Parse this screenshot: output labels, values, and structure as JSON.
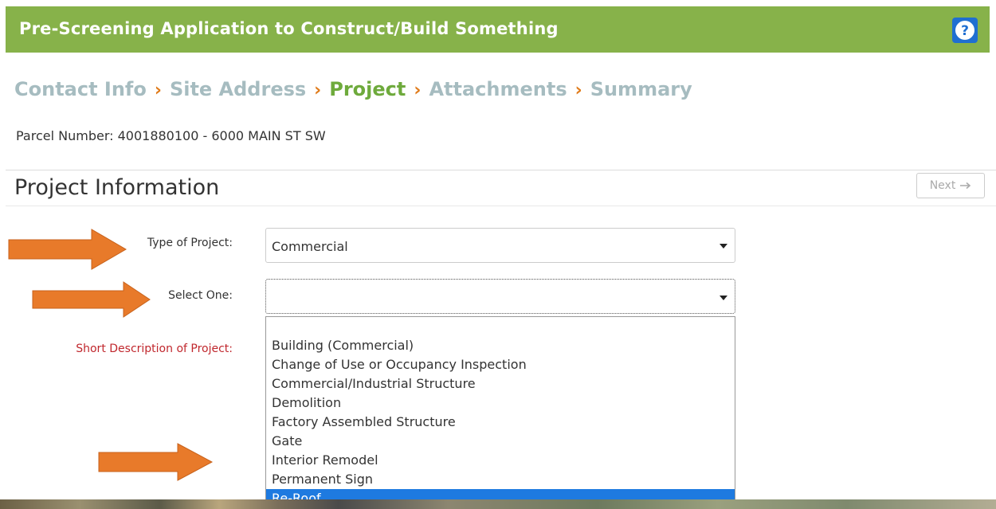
{
  "header": {
    "title": "Pre-Screening Application to Construct/Build Something",
    "help_icon": "question-circle-icon",
    "bg_color": "#87b24a",
    "help_color": "#1f6fd1"
  },
  "breadcrumb": {
    "steps": [
      "Contact Info",
      "Site Address",
      "Project",
      "Attachments",
      "Summary"
    ],
    "active_index": 2,
    "separator": "›"
  },
  "parcel": {
    "text": "Parcel Number: 4001880100 - 6000 MAIN ST SW"
  },
  "section": {
    "title": "Project Information",
    "next_label": "Next",
    "next_icon": "arrow-right-icon"
  },
  "form": {
    "type_label": "Type of Project:",
    "type_value": "Commercial",
    "select_one_label": "Select One:",
    "select_one_value": "",
    "short_desc_label": "Short Description of Project:"
  },
  "dropdown": {
    "options": [
      "",
      "Building (Commercial)",
      "Change of Use or Occupancy Inspection",
      "Commercial/Industrial Structure",
      "Demolition",
      "Factory Assembled Structure",
      "Gate",
      "Interior Remodel",
      "Permanent Sign",
      "Re-Roof"
    ],
    "selected": "Re-Roof"
  },
  "annotation_color": "#e87a2a"
}
